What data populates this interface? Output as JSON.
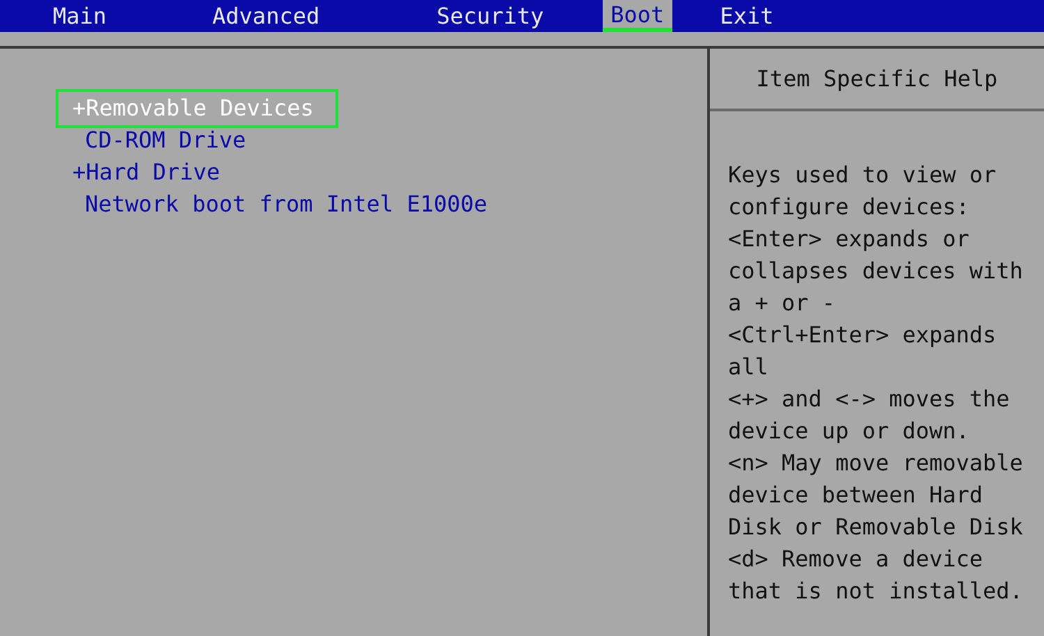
{
  "tabs": [
    {
      "label": "Main",
      "selected": false
    },
    {
      "label": "Advanced",
      "selected": false
    },
    {
      "label": "Security",
      "selected": false
    },
    {
      "label": "Boot",
      "selected": true
    },
    {
      "label": "Exit",
      "selected": false
    }
  ],
  "boot_items": [
    {
      "label": "+Removable Devices",
      "kind": "expandable",
      "selected": true
    },
    {
      "label": "CD-ROM Drive",
      "kind": "device",
      "selected": false
    },
    {
      "label": "+Hard Drive",
      "kind": "expandable",
      "selected": false
    },
    {
      "label": "Network boot from Intel E1000e",
      "kind": "device",
      "selected": false
    }
  ],
  "help_panel": {
    "title": "Item Specific Help",
    "lines": [
      "Keys used to view or",
      "configure devices:",
      "<Enter> expands or",
      "collapses devices with",
      "a + or -",
      "<Ctrl+Enter> expands",
      "all",
      "<+> and <-> moves the",
      "device up or down.",
      "<n> May move removable",
      "device between Hard",
      "Disk or Removable Disk",
      "<d> Remove a device",
      "that is not installed."
    ]
  }
}
